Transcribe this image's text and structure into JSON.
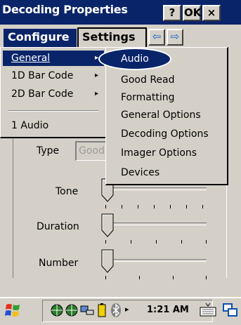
{
  "window": {
    "title": "Decoding Properties",
    "help_label": "?",
    "ok_label": "OK",
    "close_label": "×"
  },
  "tabs": {
    "configure": "Configure",
    "settings": "Settings",
    "left_arrow": "⇦",
    "right_arrow": "⇨"
  },
  "left_menu": {
    "items": [
      {
        "label": "General",
        "has_submenu": true,
        "selected": true
      },
      {
        "label": "1D Bar Code",
        "has_submenu": true
      },
      {
        "label": "2D Bar Code",
        "has_submenu": true
      },
      {
        "label": "1 Audio",
        "has_submenu": false
      }
    ],
    "arrow_glyph": "▸"
  },
  "submenu": {
    "items": [
      {
        "label": "Audio",
        "selected": true
      },
      {
        "label": "Good Read"
      },
      {
        "label": "Formatting"
      },
      {
        "label": "General Options"
      },
      {
        "label": "Decoding Options"
      },
      {
        "label": "Imager Options"
      },
      {
        "label": "Devices"
      }
    ]
  },
  "form": {
    "type_label": "Type",
    "type_value": "Good",
    "tone_label": "Tone",
    "duration_label": "Duration",
    "number_label": "Number"
  },
  "taskbar": {
    "clock": "1:21 AM",
    "arrow_glyph": "▸"
  },
  "colors": {
    "highlight": "#0a246a",
    "face": "#d4d0c8"
  }
}
